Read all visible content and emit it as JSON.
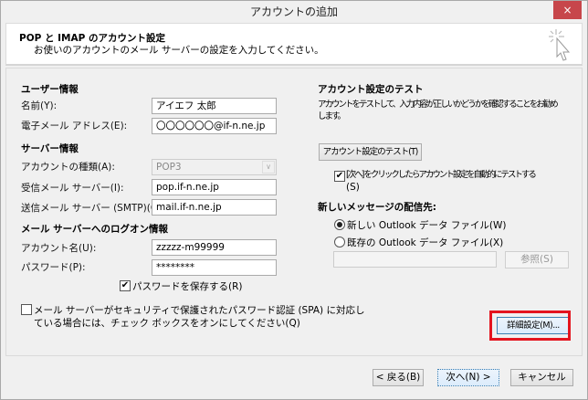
{
  "window": {
    "title": "アカウントの追加",
    "close_label": "×"
  },
  "header": {
    "title": "POP と IMAP のアカウント設定",
    "subtitle": "お使いのアカウントのメール サーバーの設定を入力してください。"
  },
  "user_info": {
    "heading": "ユーザー情報",
    "name_label": "名前(Y):",
    "name_value": "アイエフ 太郎",
    "email_label": "電子メール アドレス(E):",
    "email_value": "〇〇〇〇〇〇@if-n.ne.jp"
  },
  "server_info": {
    "heading": "サーバー情報",
    "type_label": "アカウントの種類(A):",
    "type_value": "POP3",
    "incoming_label": "受信メール サーバー(I):",
    "incoming_value": "pop.if-n.ne.jp",
    "outgoing_label": "送信メール サーバー (SMTP)(O):",
    "outgoing_value": "mail.if-n.ne.jp"
  },
  "logon": {
    "heading": "メール サーバーへのログオン情報",
    "account_label": "アカウント名(U):",
    "account_value": "zzzzz-m99999",
    "password_label": "パスワード(P):",
    "password_value": "********",
    "save_password_label": "パスワードを保存する(R)",
    "save_password_checked": true,
    "spa_label_line1": "メール サーバーがセキュリティで保護されたパスワード認証 (SPA) に対応し",
    "spa_label_line2": "ている場合には、チェック ボックスをオンにしてください(Q)",
    "spa_checked": false
  },
  "test": {
    "heading": "アカウント設定のテスト",
    "desc_line1": "アカウントをテストして、入力内容が正しいかどうかを確認することをお勧め",
    "desc_line2": "します。",
    "test_button": "アカウント設定のテスト(T)",
    "auto_test_line1": "[次へ] をクリックしたらアカウント設定を自動的にテストする",
    "auto_test_line2": "(S)",
    "auto_test_checked": true
  },
  "delivery": {
    "heading": "新しいメッセージの配信先:",
    "new_file_label": "新しい Outlook データ ファイル(W)",
    "existing_file_label": "既存の Outlook データ ファイル(X)",
    "selected": "new",
    "file_path_value": "",
    "browse_button": "参照(S)"
  },
  "more_settings_button": "詳細設定(M)...",
  "footer": {
    "back": "< 戻る(B)",
    "next": "次へ(N) >",
    "cancel": "キャンセル"
  }
}
